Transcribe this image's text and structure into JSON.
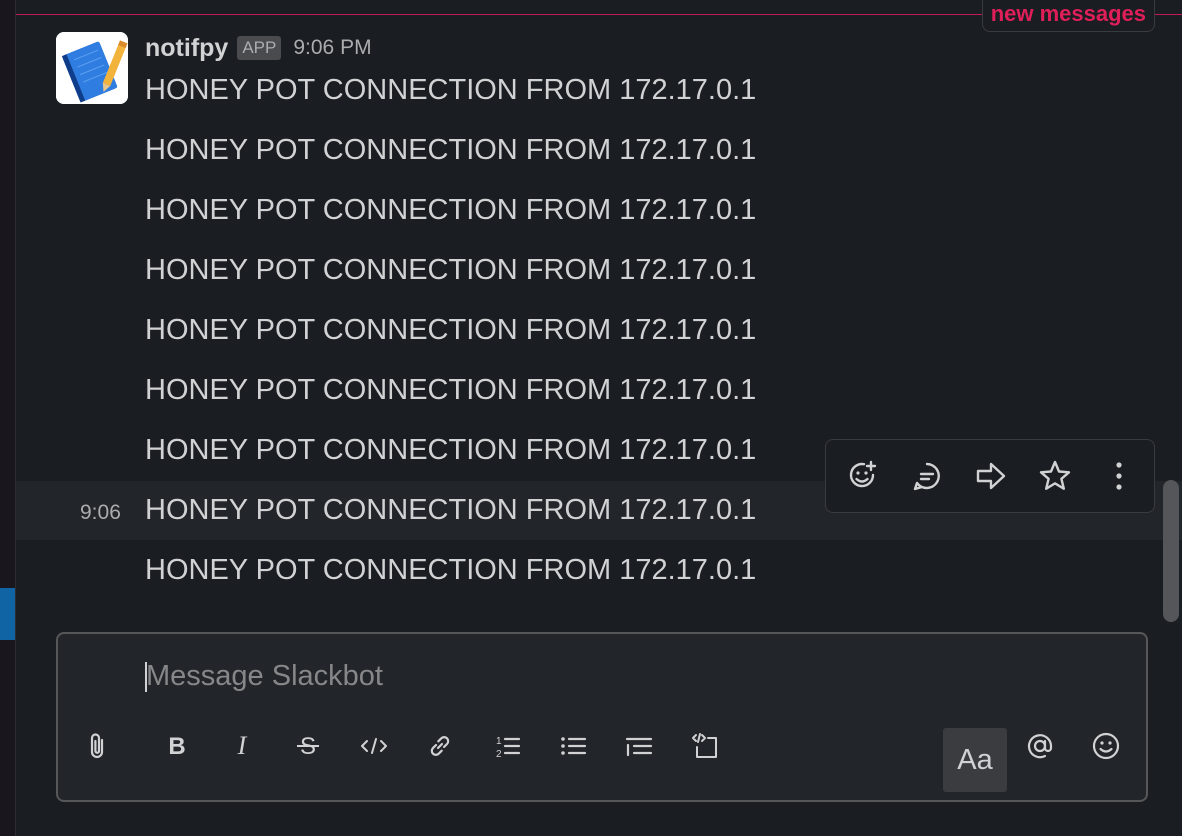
{
  "channel": {
    "new_messages_label": "new messages"
  },
  "message": {
    "sender": "notifpy",
    "badge": "APP",
    "time": "9:06 PM",
    "lines": [
      "HONEY POT CONNECTION FROM 172.17.0.1",
      "HONEY POT CONNECTION FROM 172.17.0.1",
      "HONEY POT CONNECTION FROM 172.17.0.1",
      "HONEY POT CONNECTION FROM 172.17.0.1",
      "HONEY POT CONNECTION FROM 172.17.0.1",
      "HONEY POT CONNECTION FROM 172.17.0.1",
      "HONEY POT CONNECTION FROM 172.17.0.1",
      "HONEY POT CONNECTION FROM 172.17.0.1",
      "HONEY POT CONNECTION FROM 172.17.0.1"
    ],
    "hover_time": "9:06"
  },
  "actions": [
    "add-reaction-icon",
    "reply-in-thread-icon",
    "share-message-icon",
    "save-star-icon",
    "more-actions-icon"
  ],
  "composer": {
    "placeholder": "Message Slackbot",
    "formatting_toggle_label": "Aa",
    "tools": [
      "paperclip-icon",
      "bold-icon",
      "italic-icon",
      "strikethrough-icon",
      "code-icon",
      "link-icon",
      "ordered-list-icon",
      "bulleted-list-icon",
      "blockquote-icon",
      "code-block-icon",
      "mention-icon",
      "emoji-icon"
    ]
  },
  "colors": {
    "background": "#1a1d21",
    "accent_new": "#e01e5a",
    "text": "#d1d2d3",
    "muted": "#abacad",
    "selected_sidebar": "#1164a3"
  }
}
